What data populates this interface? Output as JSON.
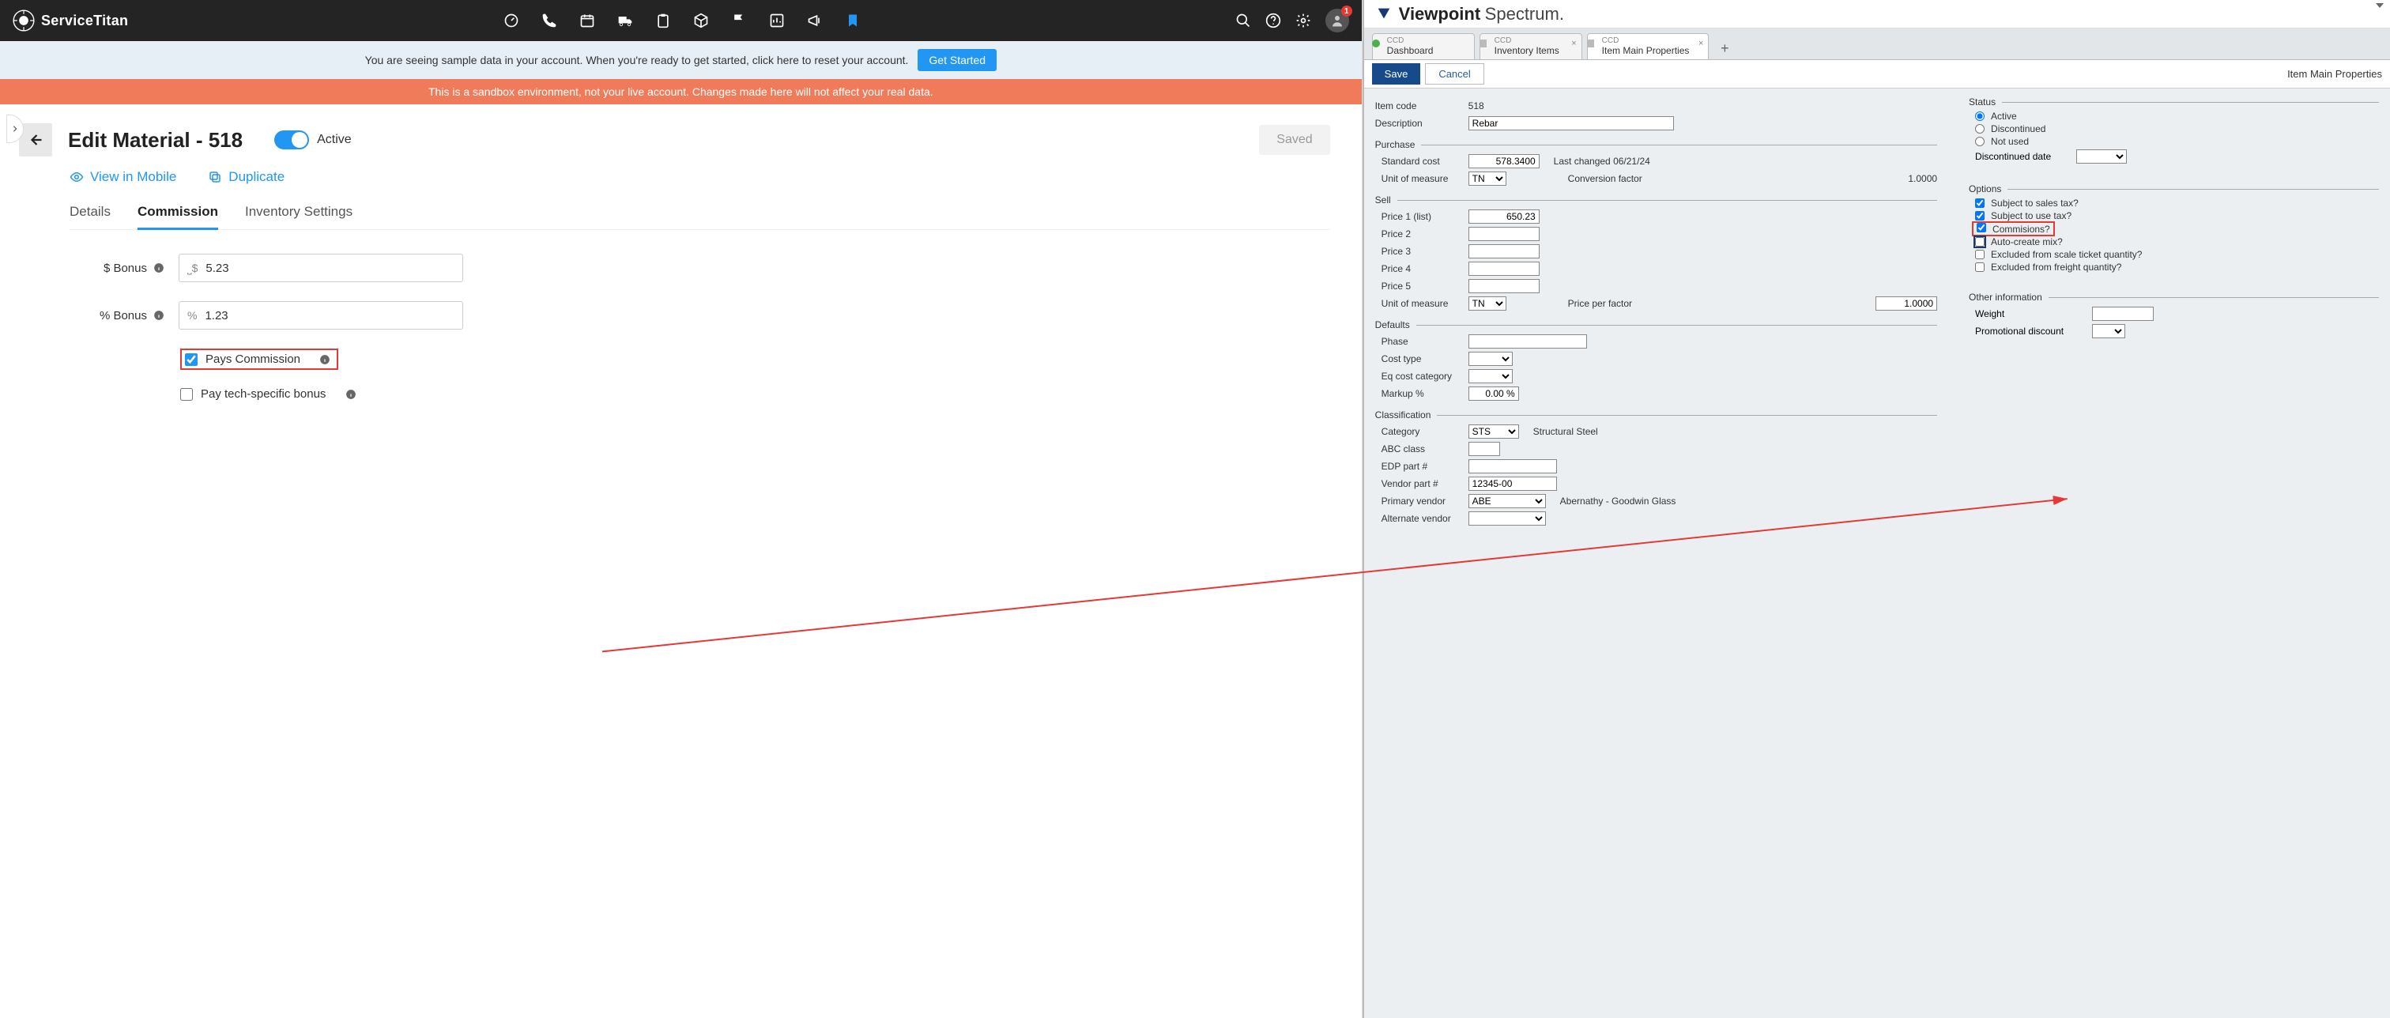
{
  "servicetitan": {
    "brand": "ServiceTitan",
    "badge": "1",
    "banner_info_text": "You are seeing sample data in your account. When you're ready to get started, click here to reset your account.",
    "banner_info_btn": "Get Started",
    "banner_warn_text": "This is a sandbox environment, not your live account. Changes made here will not affect your real data.",
    "page_title": "Edit Material - 518",
    "toggle_label": "Active",
    "saved_label": "Saved",
    "view_in_mobile": "View in Mobile",
    "duplicate": "Duplicate",
    "tabs": {
      "details": "Details",
      "commission": "Commission",
      "inventory": "Inventory Settings"
    },
    "form": {
      "bonus_dollar_label": "$ Bonus",
      "bonus_dollar_value": "5.23",
      "bonus_pct_label": "% Bonus",
      "bonus_pct_value": "1.23",
      "pays_commission_label": "Pays Commission",
      "pay_tech_bonus_label": "Pay tech-specific bonus"
    }
  },
  "viewpoint": {
    "brand_bold": "Viewpoint",
    "brand_light": "Spectrum",
    "tabs": [
      {
        "sub": "CCD",
        "main": "Dashboard"
      },
      {
        "sub": "CCD",
        "main": "Inventory Items"
      },
      {
        "sub": "CCD",
        "main": "Item Main Properties"
      }
    ],
    "save": "Save",
    "cancel": "Cancel",
    "breadcrumb": "Item Main Properties",
    "fields": {
      "item_code_lbl": "Item code",
      "item_code_val": "518",
      "description_lbl": "Description",
      "description_val": "Rebar",
      "purchase_title": "Purchase",
      "standard_cost_lbl": "Standard cost",
      "standard_cost_val": "578.3400",
      "last_changed_lbl": "Last changed",
      "last_changed_val": "06/21/24",
      "uom_lbl": "Unit of measure",
      "uom_val": "TN",
      "conv_factor_lbl": "Conversion factor",
      "conv_factor_val": "1.0000",
      "sell_title": "Sell",
      "price1_lbl": "Price 1 (list)",
      "price1_val": "650.23",
      "price2_lbl": "Price 2",
      "price3_lbl": "Price 3",
      "price4_lbl": "Price 4",
      "price5_lbl": "Price 5",
      "price_per_factor_lbl": "Price per factor",
      "price_per_factor_val": "1.0000",
      "defaults_title": "Defaults",
      "phase_lbl": "Phase",
      "cost_type_lbl": "Cost type",
      "eq_cost_cat_lbl": "Eq cost category",
      "markup_lbl": "Markup %",
      "markup_val": "0.00 %",
      "classification_title": "Classification",
      "category_lbl": "Category",
      "category_val": "STS",
      "category_desc": "Structural Steel",
      "abc_lbl": "ABC class",
      "edp_lbl": "EDP part #",
      "vendor_part_lbl": "Vendor part #",
      "vendor_part_val": "12345-00",
      "primary_vendor_lbl": "Primary vendor",
      "primary_vendor_val": "ABE",
      "primary_vendor_desc": "Abernathy - Goodwin Glass",
      "alternate_vendor_lbl": "Alternate vendor"
    },
    "right": {
      "status_title": "Status",
      "status_active": "Active",
      "status_discontinued": "Discontinued",
      "status_not_used": "Not used",
      "discontinued_date_lbl": "Discontinued date",
      "options_title": "Options",
      "opt_sales_tax": "Subject to sales tax?",
      "opt_use_tax": "Subject to use tax?",
      "opt_commissions": "Commisions?",
      "opt_auto_mix": "Auto-create mix?",
      "opt_excl_scale": "Excluded from scale ticket quantity?",
      "opt_excl_freight": "Excluded from freight quantity?",
      "other_info_title": "Other information",
      "weight_lbl": "Weight",
      "promo_discount_lbl": "Promotional discount"
    }
  }
}
